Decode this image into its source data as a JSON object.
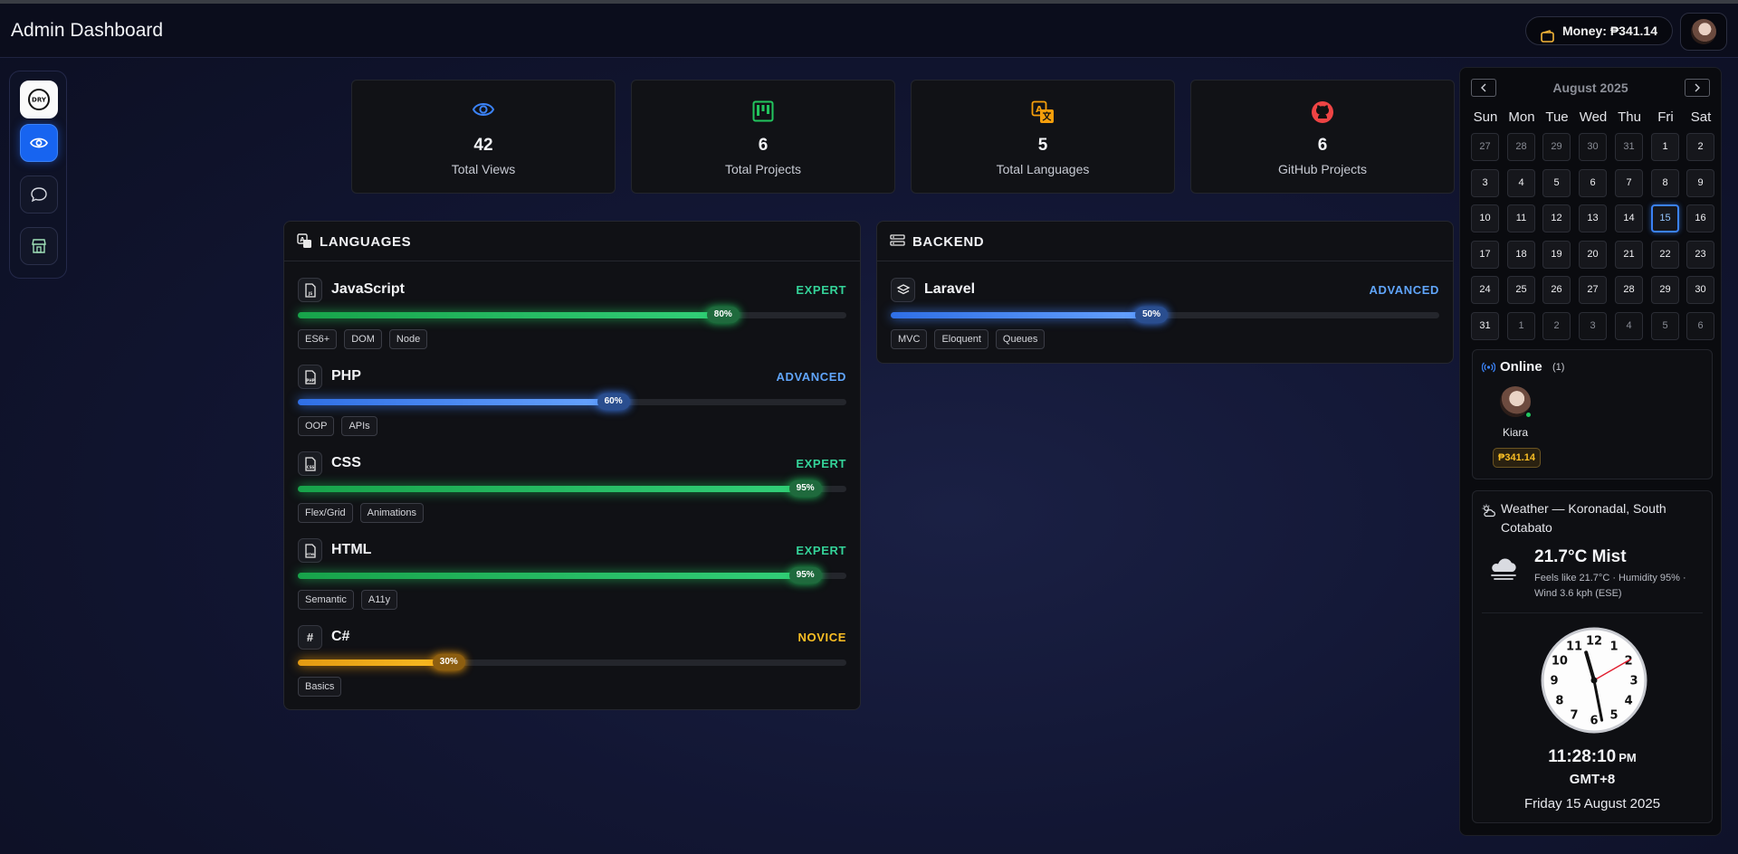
{
  "header": {
    "title": "Admin Dashboard",
    "money_label": "Money: ₱341.14"
  },
  "sidebar": {
    "items": [
      "logo",
      "views",
      "messages",
      "store"
    ]
  },
  "stats": [
    {
      "value": "42",
      "label": "Total Views",
      "icon": "eye-icon",
      "color": "#3b82f6"
    },
    {
      "value": "6",
      "label": "Total Projects",
      "icon": "kanban-icon",
      "color": "#22c55e"
    },
    {
      "value": "5",
      "label": "Total Languages",
      "icon": "translate-icon",
      "color": "#f59e0b"
    },
    {
      "value": "6",
      "label": "GitHub Projects",
      "icon": "github-icon",
      "color": "#ef4444"
    }
  ],
  "languages": {
    "title": "LANGUAGES",
    "skills": [
      {
        "name": "JavaScript",
        "level": "EXPERT",
        "percent": 80,
        "pct_label": "80%",
        "icon": "file-js-icon",
        "tags": [
          "ES6+",
          "DOM",
          "Node"
        ]
      },
      {
        "name": "PHP",
        "level": "ADVANCED",
        "percent": 60,
        "pct_label": "60%",
        "icon": "file-php-icon",
        "tags": [
          "OOP",
          "APIs"
        ]
      },
      {
        "name": "CSS",
        "level": "EXPERT",
        "percent": 95,
        "pct_label": "95%",
        "icon": "file-css-icon",
        "tags": [
          "Flex/Grid",
          "Animations"
        ]
      },
      {
        "name": "HTML",
        "level": "EXPERT",
        "percent": 95,
        "pct_label": "95%",
        "icon": "file-html-icon",
        "tags": [
          "Semantic",
          "A11y"
        ]
      },
      {
        "name": "C#",
        "level": "NOVICE",
        "percent": 30,
        "pct_label": "30%",
        "icon": "hash-icon",
        "icon_text": "#",
        "tags": [
          "Basics"
        ]
      }
    ]
  },
  "backend": {
    "title": "BACKEND",
    "skills": [
      {
        "name": "Laravel",
        "level": "ADVANCED",
        "percent": 50,
        "pct_label": "50%",
        "icon": "layers-icon",
        "tags": [
          "MVC",
          "Eloquent",
          "Queues"
        ]
      }
    ]
  },
  "calendar": {
    "title": "August 2025",
    "weekdays": [
      "Sun",
      "Mon",
      "Tue",
      "Wed",
      "Thu",
      "Fri",
      "Sat"
    ],
    "weeks": [
      [
        "27",
        "28",
        "29",
        "30",
        "31",
        "1",
        "2"
      ],
      [
        "3",
        "4",
        "5",
        "6",
        "7",
        "8",
        "9"
      ],
      [
        "10",
        "11",
        "12",
        "13",
        "14",
        "15",
        "16"
      ],
      [
        "17",
        "18",
        "19",
        "20",
        "21",
        "22",
        "23"
      ],
      [
        "24",
        "25",
        "26",
        "27",
        "28",
        "29",
        "30"
      ],
      [
        "31",
        "1",
        "2",
        "3",
        "4",
        "5",
        "6"
      ]
    ],
    "today": "15"
  },
  "online": {
    "title": "Online",
    "count": "(1)",
    "user": "Kiara",
    "money": "₱341.14"
  },
  "weather": {
    "title": "Weather — Koronadal, South Cotabato",
    "temp": "21.7°C Mist",
    "details": "Feels like 21.7°C · Humidity 95% · Wind 3.6 kph (ESE)",
    "time": "11:28:10",
    "ampm": "PM",
    "timezone": "GMT+8",
    "date": "Friday 15 August 2025",
    "clock_numbers": [
      "12",
      "1",
      "2",
      "3",
      "4",
      "5",
      "6",
      "7",
      "8",
      "9",
      "10",
      "11"
    ]
  }
}
